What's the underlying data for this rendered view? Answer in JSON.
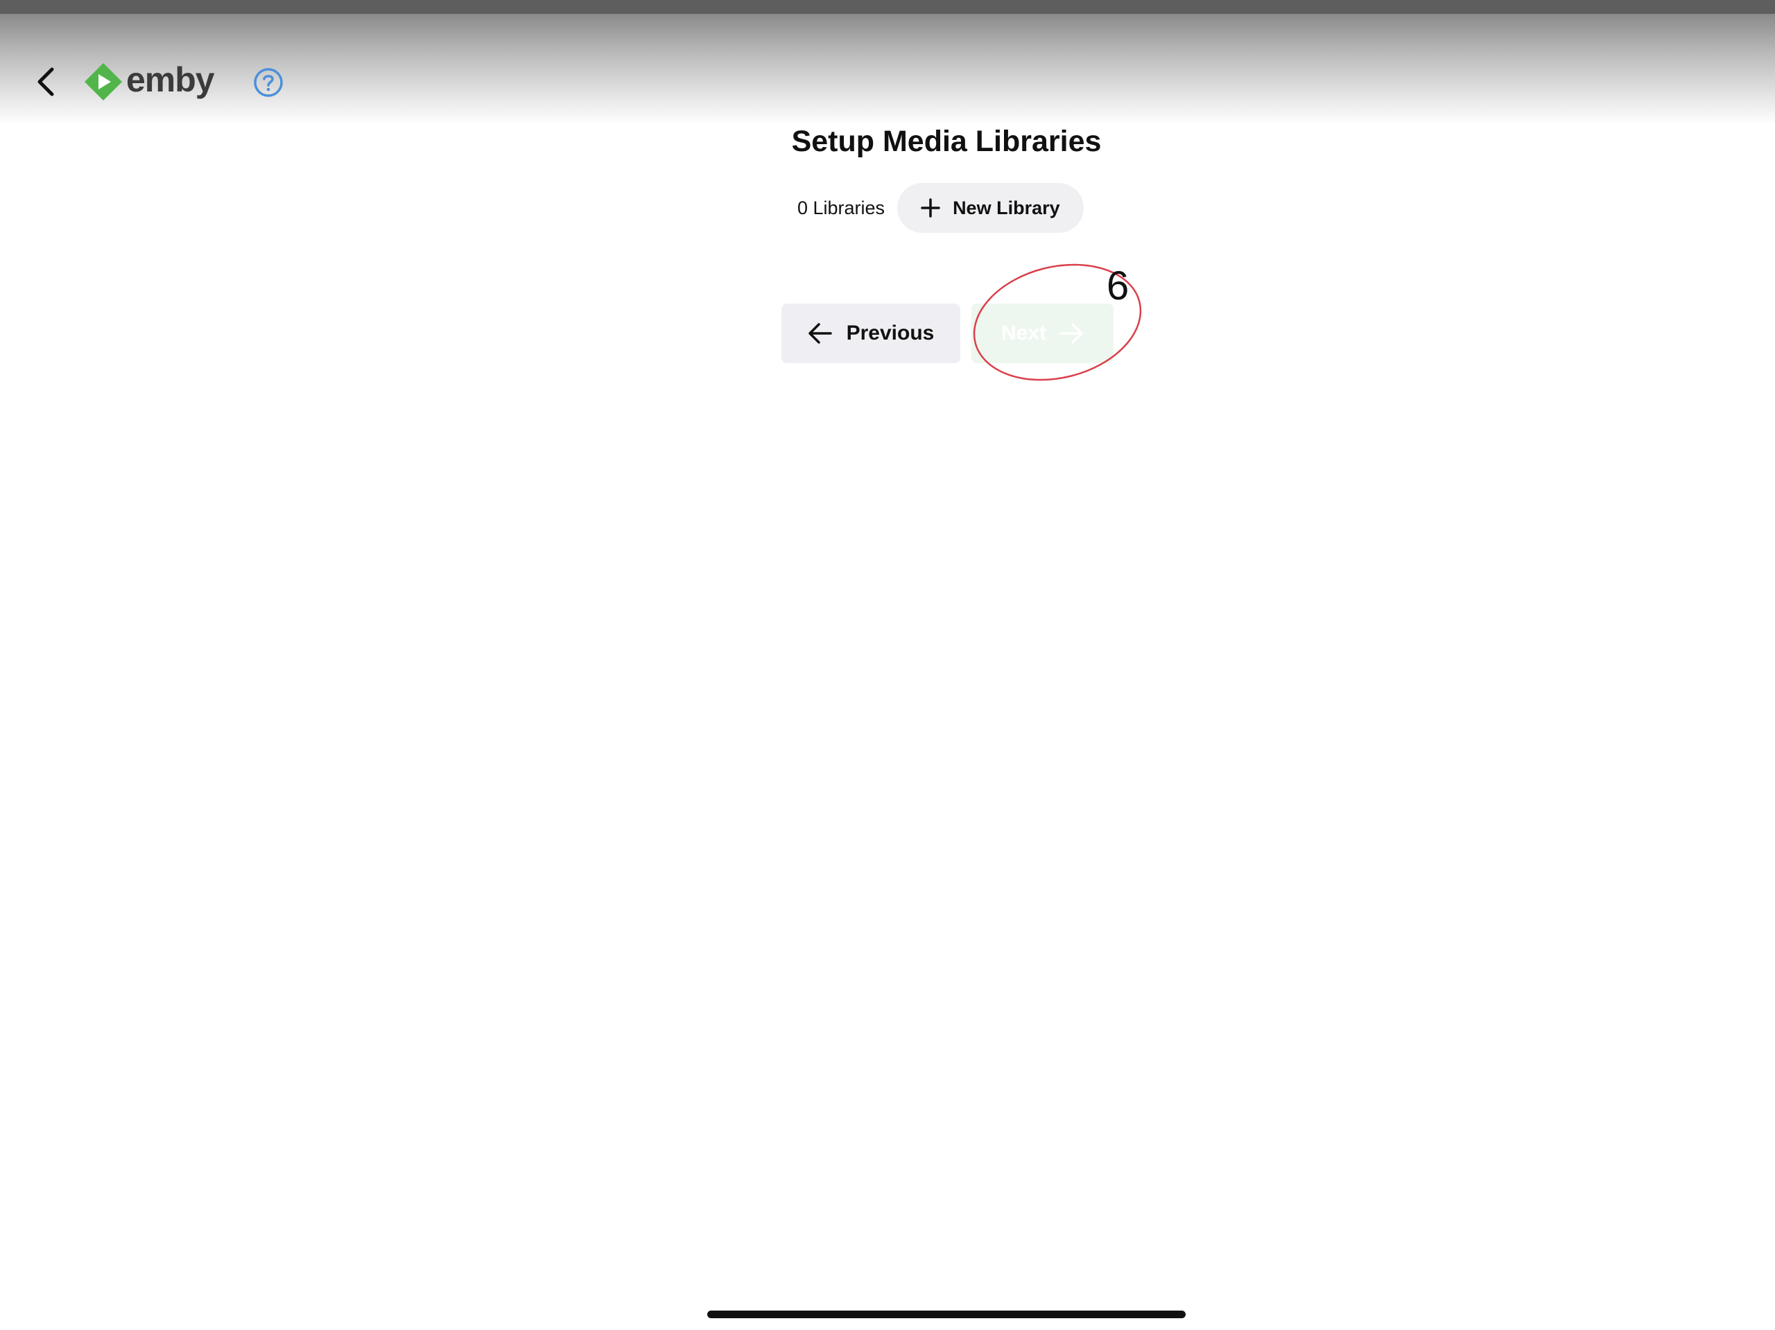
{
  "header": {
    "logo_text": "emby",
    "back_icon": "chevron-left-icon",
    "help_icon": "question-circle-icon"
  },
  "main": {
    "title": "Setup Media Libraries",
    "library_count": "0 Libraries",
    "new_library_label": "New Library",
    "previous_label": "Previous",
    "next_label": "Next"
  },
  "annotation": {
    "number": "6",
    "color": "#d9404b"
  },
  "colors": {
    "brand_green": "#52b54b",
    "help_blue": "#4a90d9"
  }
}
